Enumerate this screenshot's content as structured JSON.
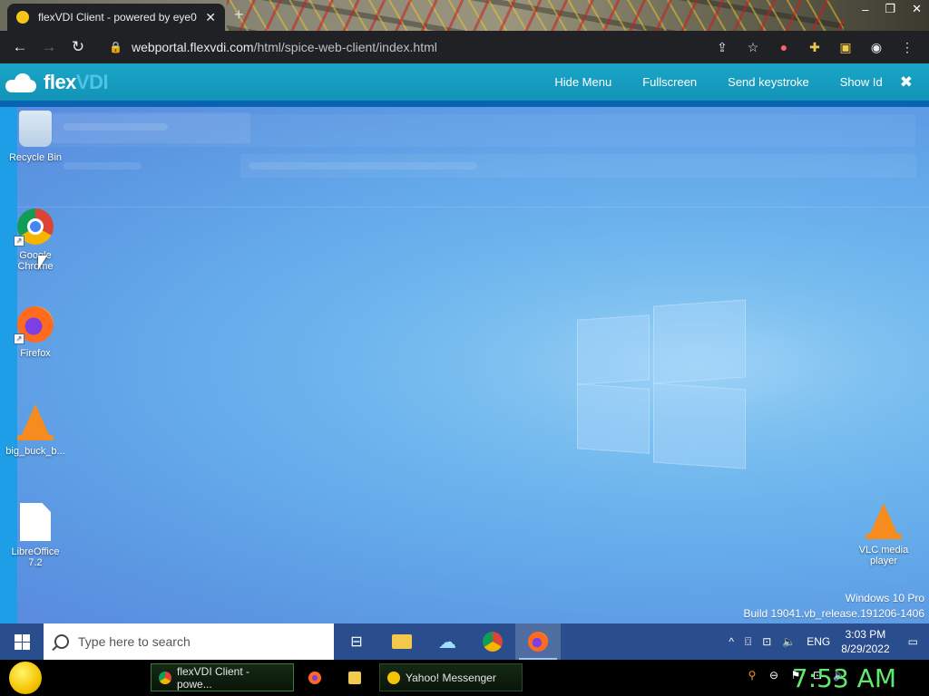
{
  "browser": {
    "tab_title": "flexVDI Client - powered by eye0",
    "url_host": "webportal.flexvdi.com",
    "url_path": "/html/spice-web-client/index.html"
  },
  "flexvdi": {
    "brand_a": "flex",
    "brand_b": "VDI",
    "menu": [
      "Hide Menu",
      "Fullscreen",
      "Send keystroke",
      "Show Id"
    ]
  },
  "desktop": {
    "icons": [
      {
        "label": "Recycle Bin"
      },
      {
        "label": "Google Chrome"
      },
      {
        "label": "Firefox"
      },
      {
        "label": "big_buck_b..."
      },
      {
        "label": "LibreOffice 7.2"
      },
      {
        "label": "VLC media player"
      }
    ],
    "watermark_line1": "Windows 10 Pro",
    "watermark_line2": "Build 19041.vb_release.191206-1406"
  },
  "win_taskbar": {
    "search_placeholder": "Type here to search",
    "lang": "ENG",
    "time": "3:03 PM",
    "date": "8/29/2022"
  },
  "host_taskbar": {
    "buttons": [
      "flexVDI Client - powe...",
      "Yahoo! Messenger"
    ],
    "clock": "7:53 AM"
  }
}
